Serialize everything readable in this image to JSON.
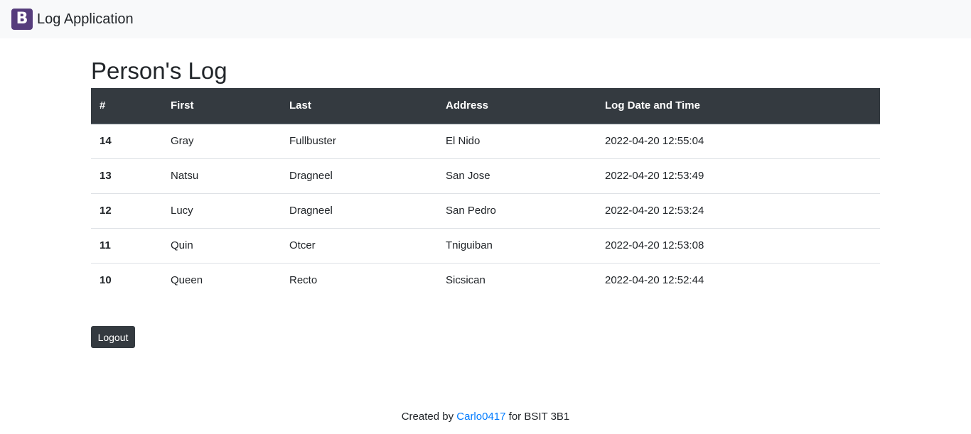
{
  "navbar": {
    "logo_letter": "B",
    "brand_text": "Log Application"
  },
  "main": {
    "title": "Person's Log",
    "table": {
      "headers": [
        "#",
        "First",
        "Last",
        "Address",
        "Log Date and Time"
      ],
      "rows": [
        {
          "num": "14",
          "first": "Gray",
          "last": "Fullbuster",
          "address": "El Nido",
          "datetime": "2022-04-20 12:55:04"
        },
        {
          "num": "13",
          "first": "Natsu",
          "last": "Dragneel",
          "address": "San Jose",
          "datetime": "2022-04-20 12:53:49"
        },
        {
          "num": "12",
          "first": "Lucy",
          "last": "Dragneel",
          "address": "San Pedro",
          "datetime": "2022-04-20 12:53:24"
        },
        {
          "num": "11",
          "first": "Quin",
          "last": "Otcer",
          "address": "Tniguiban",
          "datetime": "2022-04-20 12:53:08"
        },
        {
          "num": "10",
          "first": "Queen",
          "last": "Recto",
          "address": "Sicsican",
          "datetime": "2022-04-20 12:52:44"
        }
      ]
    },
    "logout_label": "Logout"
  },
  "footer": {
    "prefix": "Created by",
    "author": "Carlo0417",
    "suffix": "for BSIT 3B1"
  },
  "colors": {
    "navbar_bg": "#f8f9fa",
    "brand_logo": "#563d7c",
    "table_header_bg": "#343a40",
    "link": "#007bff"
  }
}
